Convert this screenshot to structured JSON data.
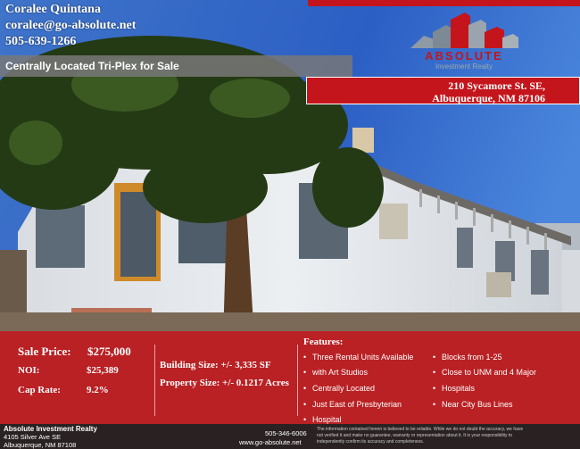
{
  "contact": {
    "name": "Coralee Quintana",
    "email": "coralee@go-absolute.net",
    "phone": "505-639-1266"
  },
  "logo": {
    "word": "ABSOLUTE",
    "sub": "Investment Realty"
  },
  "listing": {
    "headline": "Centrally Located Tri-Plex for Sale",
    "address_line1": "210 Sycamore St. SE,",
    "address_line2": "Albuquerque, NM 87106"
  },
  "financials": {
    "sale_price_label": "Sale Price:",
    "sale_price_value": "$275,000",
    "noi_label": "NOI:",
    "noi_value": "$25,389",
    "cap_rate_label": "Cap Rate:",
    "cap_rate_value": "9.2%"
  },
  "property": {
    "building_size": "Building Size: +/- 3,335 SF",
    "property_size": "Property Size: +/- 0.1217 Acres"
  },
  "features": {
    "title": "Features:",
    "col1": [
      "Three Rental Units Available",
      "with Art Studios",
      "Centrally Located",
      "Just East of Presbyterian",
      "Hospital"
    ],
    "col2": [
      "Blocks from 1-25",
      "Close to UNM and 4 Major",
      "Hospitals",
      "Near City Bus Lines"
    ]
  },
  "footer": {
    "company": "Absolute Investment Realty",
    "street": "4105 Silver Ave SE",
    "city": "Albuquerque, NM 87108",
    "phone": "505-346-6006",
    "website": "www.go-absolute.net",
    "disclaimer_1": "The information contained herein is believed to be reliable. While we do not doubt the accuracy, we have",
    "disclaimer_2": "not verified it and make no guarantee, warranty or representation about it. It is your responsibility to",
    "disclaimer_3": "independently confirm its accuracy and completeness."
  },
  "colors": {
    "brand_red": "#c4151c",
    "sky_blue": "#3a7ad0",
    "wall_white": "#e9ecef"
  }
}
